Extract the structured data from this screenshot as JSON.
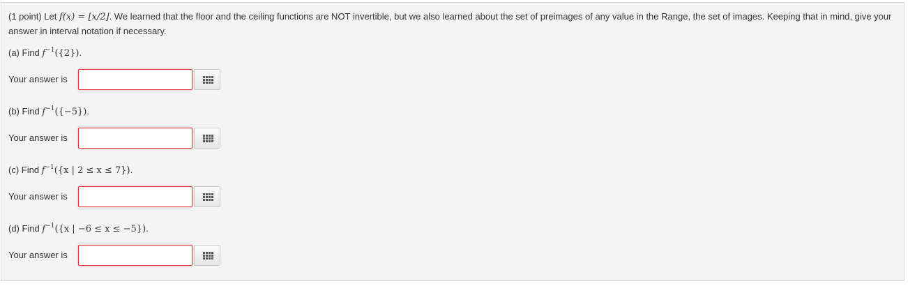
{
  "problem": {
    "prefix": "(1 point) Let ",
    "function": "f(x) = ⌊x/2⌋",
    "text": ". We learned that the floor and the ceiling functions are NOT invertible, but we also learned about the set of preimages of any value in the Range, the set of images. Keeping that in mind, give your answer in interval notation if necessary."
  },
  "answer_label": "Your answer is",
  "parts": [
    {
      "label": "(a) Find ",
      "fn": "f",
      "sup": "−1",
      "arg": "({2})",
      "end": ".",
      "answer_value": ""
    },
    {
      "label": "(b) Find ",
      "fn": "f",
      "sup": "−1",
      "arg": "({−5})",
      "end": ".",
      "answer_value": ""
    },
    {
      "label": "(c) Find ",
      "fn": "f",
      "sup": "−1",
      "arg": "({x | 2 ≤ x ≤ 7})",
      "end": ".",
      "answer_value": ""
    },
    {
      "label": "(d) Find ",
      "fn": "f",
      "sup": "−1",
      "arg": "({x | −6 ≤ x ≤ −5})",
      "end": ".",
      "answer_value": ""
    }
  ],
  "colors": {
    "panel_bg": "#f4f4f4",
    "input_border_error": "#e3333a",
    "text": "#333333"
  },
  "icons": {
    "palette": "equation-palette-grid-icon"
  }
}
